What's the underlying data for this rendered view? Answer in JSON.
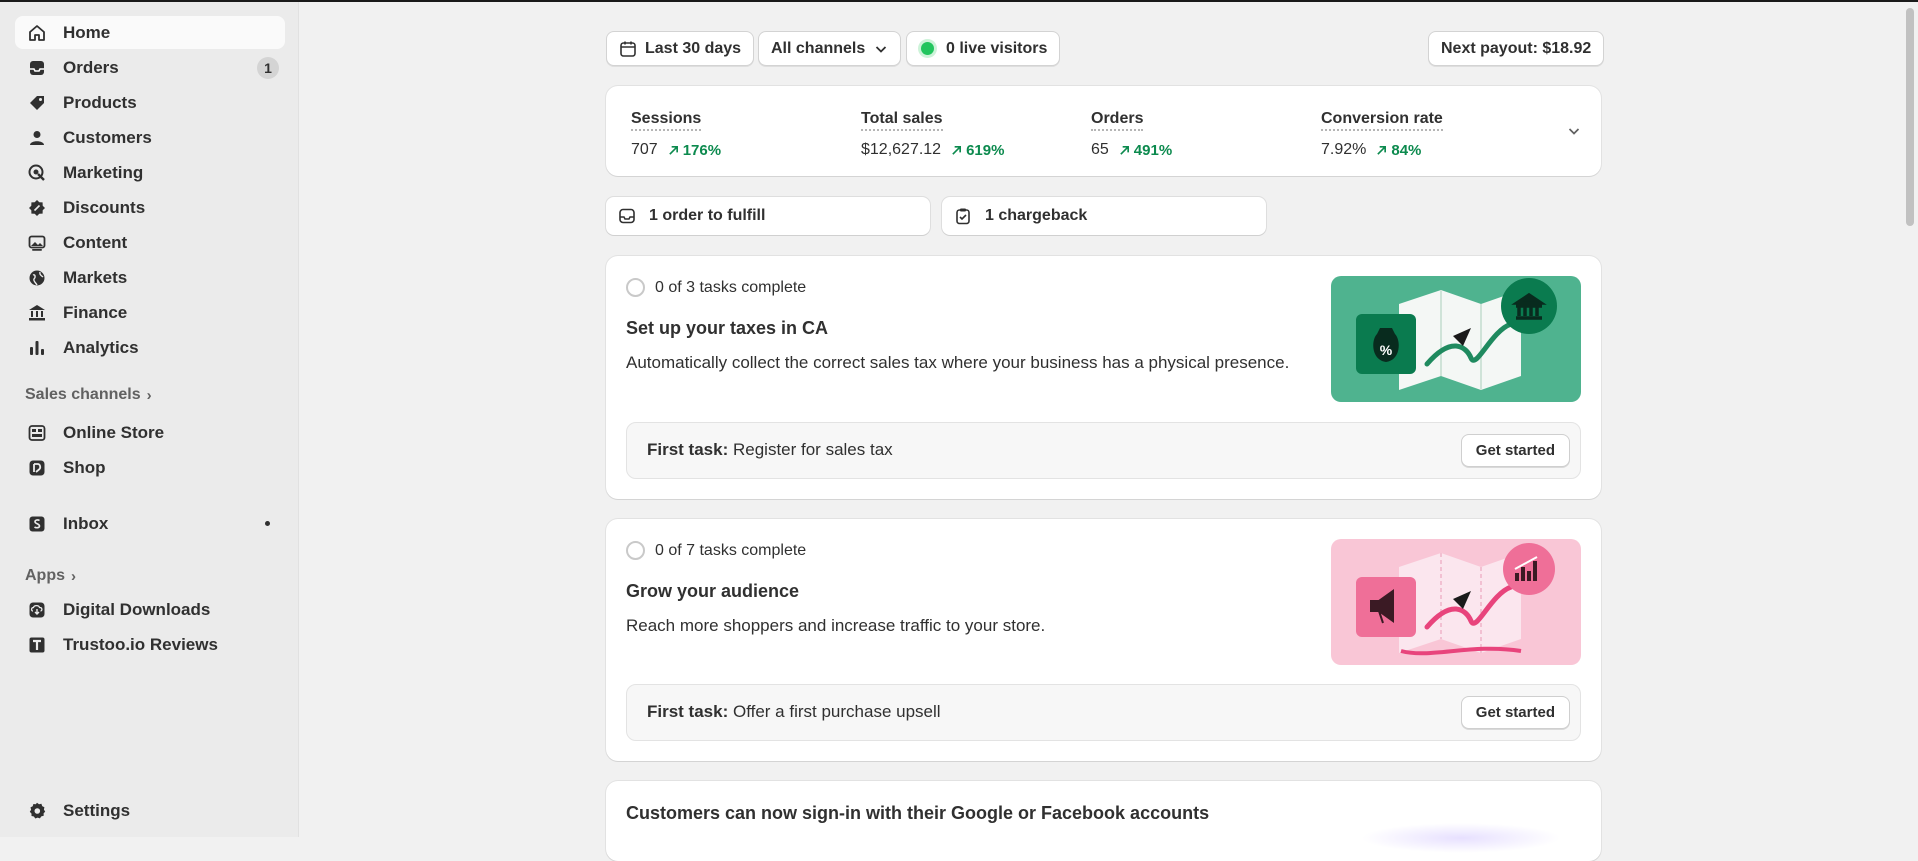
{
  "sidebar": {
    "items": [
      {
        "label": "Home",
        "icon": "home-icon"
      },
      {
        "label": "Orders",
        "icon": "inbox-icon",
        "badge": "1"
      },
      {
        "label": "Products",
        "icon": "tag-icon"
      },
      {
        "label": "Customers",
        "icon": "person-icon"
      },
      {
        "label": "Marketing",
        "icon": "target-icon"
      },
      {
        "label": "Discounts",
        "icon": "discount-icon"
      },
      {
        "label": "Content",
        "icon": "image-icon"
      },
      {
        "label": "Markets",
        "icon": "globe-icon"
      },
      {
        "label": "Finance",
        "icon": "bank-icon"
      },
      {
        "label": "Analytics",
        "icon": "bar-chart-icon"
      }
    ],
    "sales_channels_label": "Sales channels",
    "channels": [
      {
        "label": "Online Store",
        "icon": "store-icon"
      },
      {
        "label": "Shop",
        "icon": "shop-icon"
      }
    ],
    "inbox_label": "Inbox",
    "apps_label": "Apps",
    "apps": [
      {
        "label": "Digital Downloads",
        "icon": "download-icon"
      },
      {
        "label": "Trustoo.io Reviews",
        "icon": "trustoo-icon"
      }
    ],
    "settings_label": "Settings"
  },
  "toolbar": {
    "date_range": "Last 30 days",
    "channels": "All channels",
    "live_visitors": "0 live visitors",
    "payout": "Next payout: $18.92"
  },
  "metrics": [
    {
      "label": "Sessions",
      "value": "707",
      "change": "176%"
    },
    {
      "label": "Total sales",
      "value": "$12,627.12",
      "change": "619%"
    },
    {
      "label": "Orders",
      "value": "65",
      "change": "491%"
    },
    {
      "label": "Conversion rate",
      "value": "7.92%",
      "change": "84%"
    }
  ],
  "tasks": {
    "fulfill": "1 order to fulfill",
    "chargeback": "1 chargeback"
  },
  "setup_cards": [
    {
      "progress": "0 of 3 tasks complete",
      "title": "Set up your taxes in CA",
      "description": "Automatically collect the correct sales tax where your business has a physical presence.",
      "first_task_label": "First task:",
      "first_task": "Register for sales tax",
      "button": "Get started",
      "accent": "#4fb38f"
    },
    {
      "progress": "0 of 7 tasks complete",
      "title": "Grow your audience",
      "description": "Reach more shoppers and increase traffic to your store.",
      "first_task_label": "First task:",
      "first_task": "Offer a first purchase upsell",
      "button": "Get started",
      "accent": "#f7b8cf"
    }
  ],
  "announcement": {
    "title": "Customers can now sign-in with their Google or Facebook accounts"
  },
  "colors": {
    "positive": "#0c8a4e",
    "live_dot": "#22c55e"
  }
}
